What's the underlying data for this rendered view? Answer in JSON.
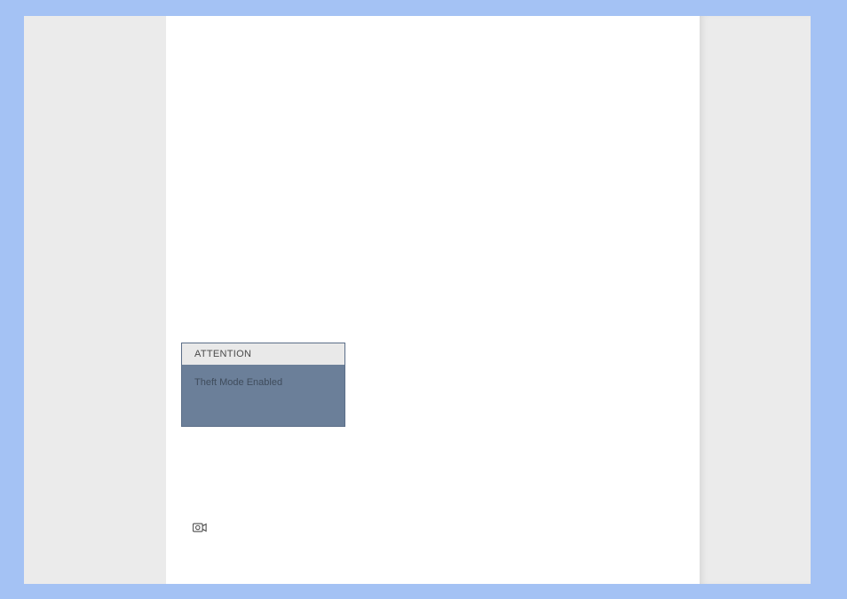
{
  "attention_box": {
    "header": "ATTENTION",
    "message": "Theft Mode Enabled"
  }
}
